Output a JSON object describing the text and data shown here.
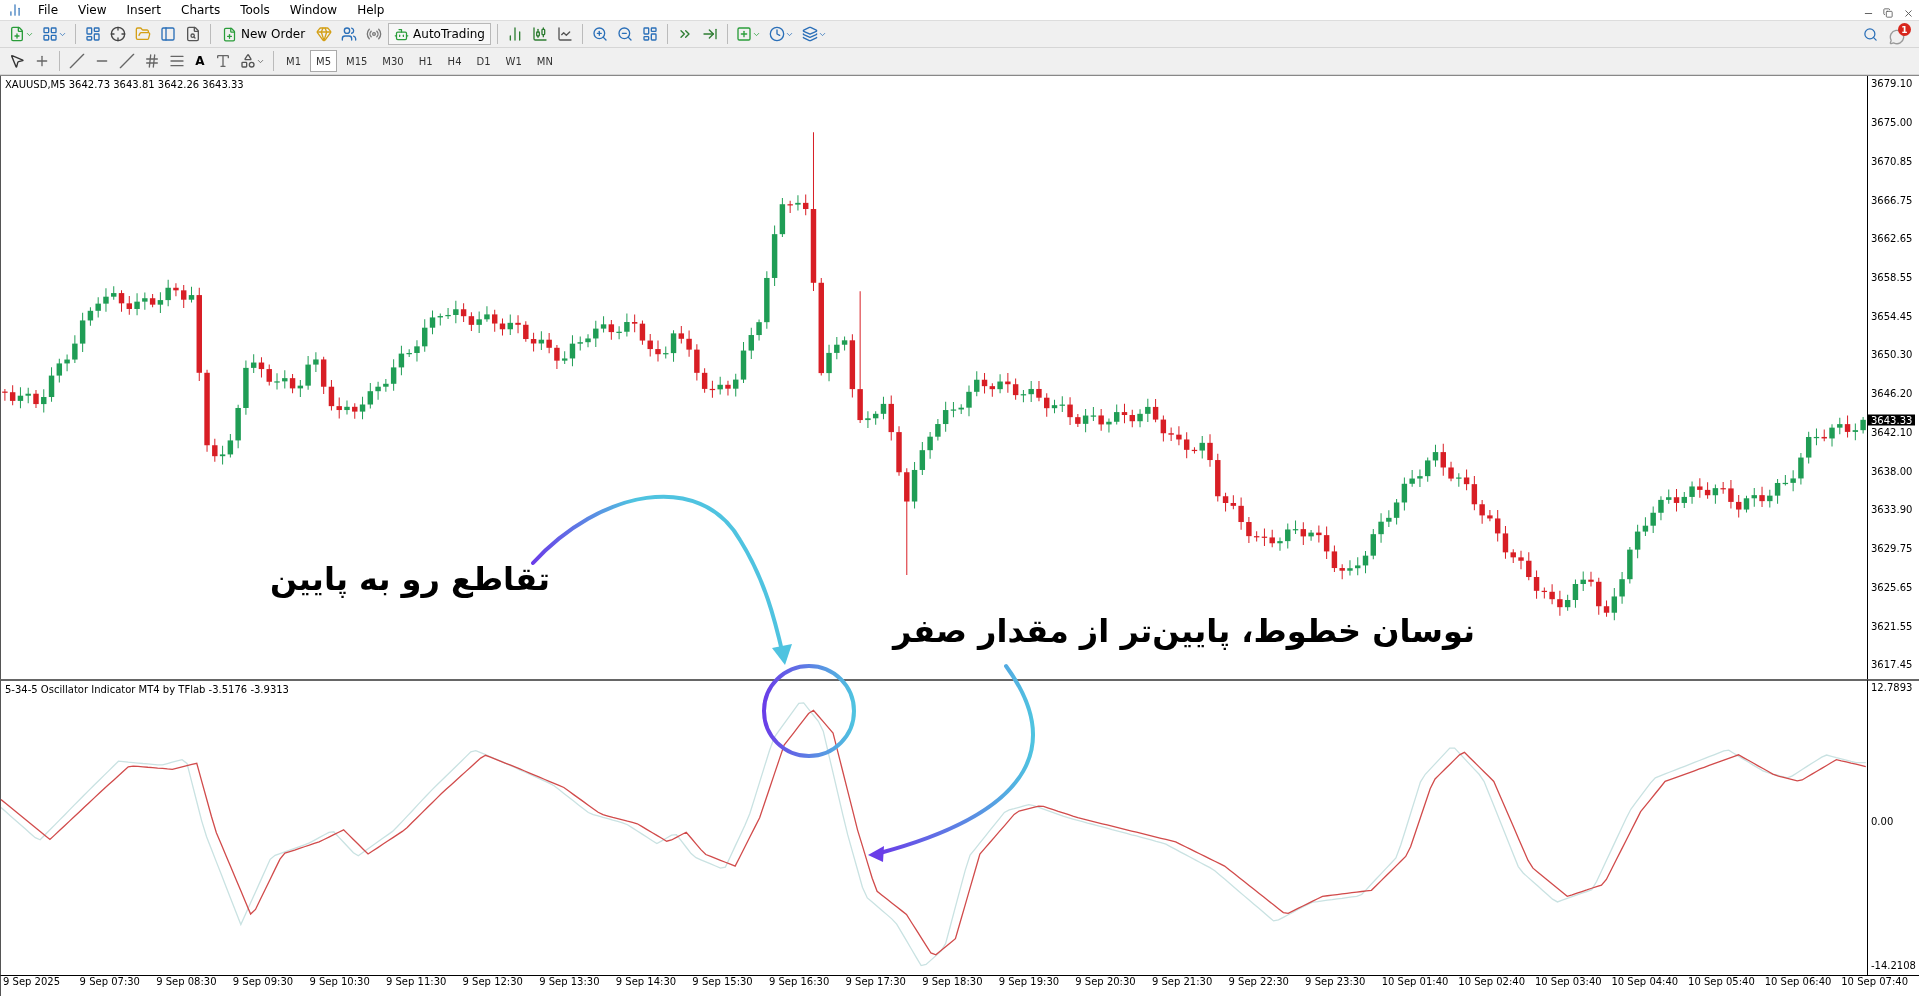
{
  "menu": [
    {
      "label": "File"
    },
    {
      "label": "View"
    },
    {
      "label": "Insert"
    },
    {
      "label": "Charts"
    },
    {
      "label": "Tools"
    },
    {
      "label": "Window"
    },
    {
      "label": "Help"
    }
  ],
  "toolbar": {
    "new_order": "New Order",
    "auto_trading": "AutoTrading"
  },
  "drawing_tools": {
    "text_tool": "A"
  },
  "timeframes": [
    {
      "label": "M1",
      "selected": false
    },
    {
      "label": "M5",
      "selected": true
    },
    {
      "label": "M15",
      "selected": false
    },
    {
      "label": "M30",
      "selected": false
    },
    {
      "label": "H1",
      "selected": false
    },
    {
      "label": "H4",
      "selected": false
    },
    {
      "label": "D1",
      "selected": false
    },
    {
      "label": "W1",
      "selected": false
    },
    {
      "label": "MN",
      "selected": false
    }
  ],
  "notifications": {
    "count": "1"
  },
  "chart": {
    "title": "XAUUSD,M5  3642.73 3643.81 3642.26 3643.33",
    "current_price": "3643.33",
    "price_axis": [
      "3679.10",
      "3675.00",
      "3670.85",
      "3666.75",
      "3662.65",
      "3658.55",
      "3654.45",
      "3650.30",
      "3646.20",
      "3642.10",
      "3638.00",
      "3633.90",
      "3629.75",
      "3625.65",
      "3621.55",
      "3617.45"
    ]
  },
  "indicator": {
    "title": "5-34-5 Oscillator Indicator MT4 by TFlab -3.5176 -3.9313",
    "axis": [
      "12.7893",
      "0.00",
      "-14.2108"
    ]
  },
  "time_axis": [
    "9 Sep 2025",
    "9 Sep 07:30",
    "9 Sep 08:30",
    "9 Sep 09:30",
    "9 Sep 10:30",
    "9 Sep 11:30",
    "9 Sep 12:30",
    "9 Sep 13:30",
    "9 Sep 14:30",
    "9 Sep 15:30",
    "9 Sep 16:30",
    "9 Sep 17:30",
    "9 Sep 18:30",
    "9 Sep 19:30",
    "9 Sep 20:30",
    "9 Sep 21:30",
    "9 Sep 22:30",
    "9 Sep 23:30",
    "10 Sep 01:40",
    "10 Sep 02:40",
    "10 Sep 03:40",
    "10 Sep 04:40",
    "10 Sep 05:40",
    "10 Sep 06:40",
    "10 Sep 07:40"
  ],
  "annotations": [
    {
      "text": "تقاطع رو به پایین"
    },
    {
      "text": "نوسان خطوط، پایین‌تر از مقدار صفر"
    }
  ]
}
